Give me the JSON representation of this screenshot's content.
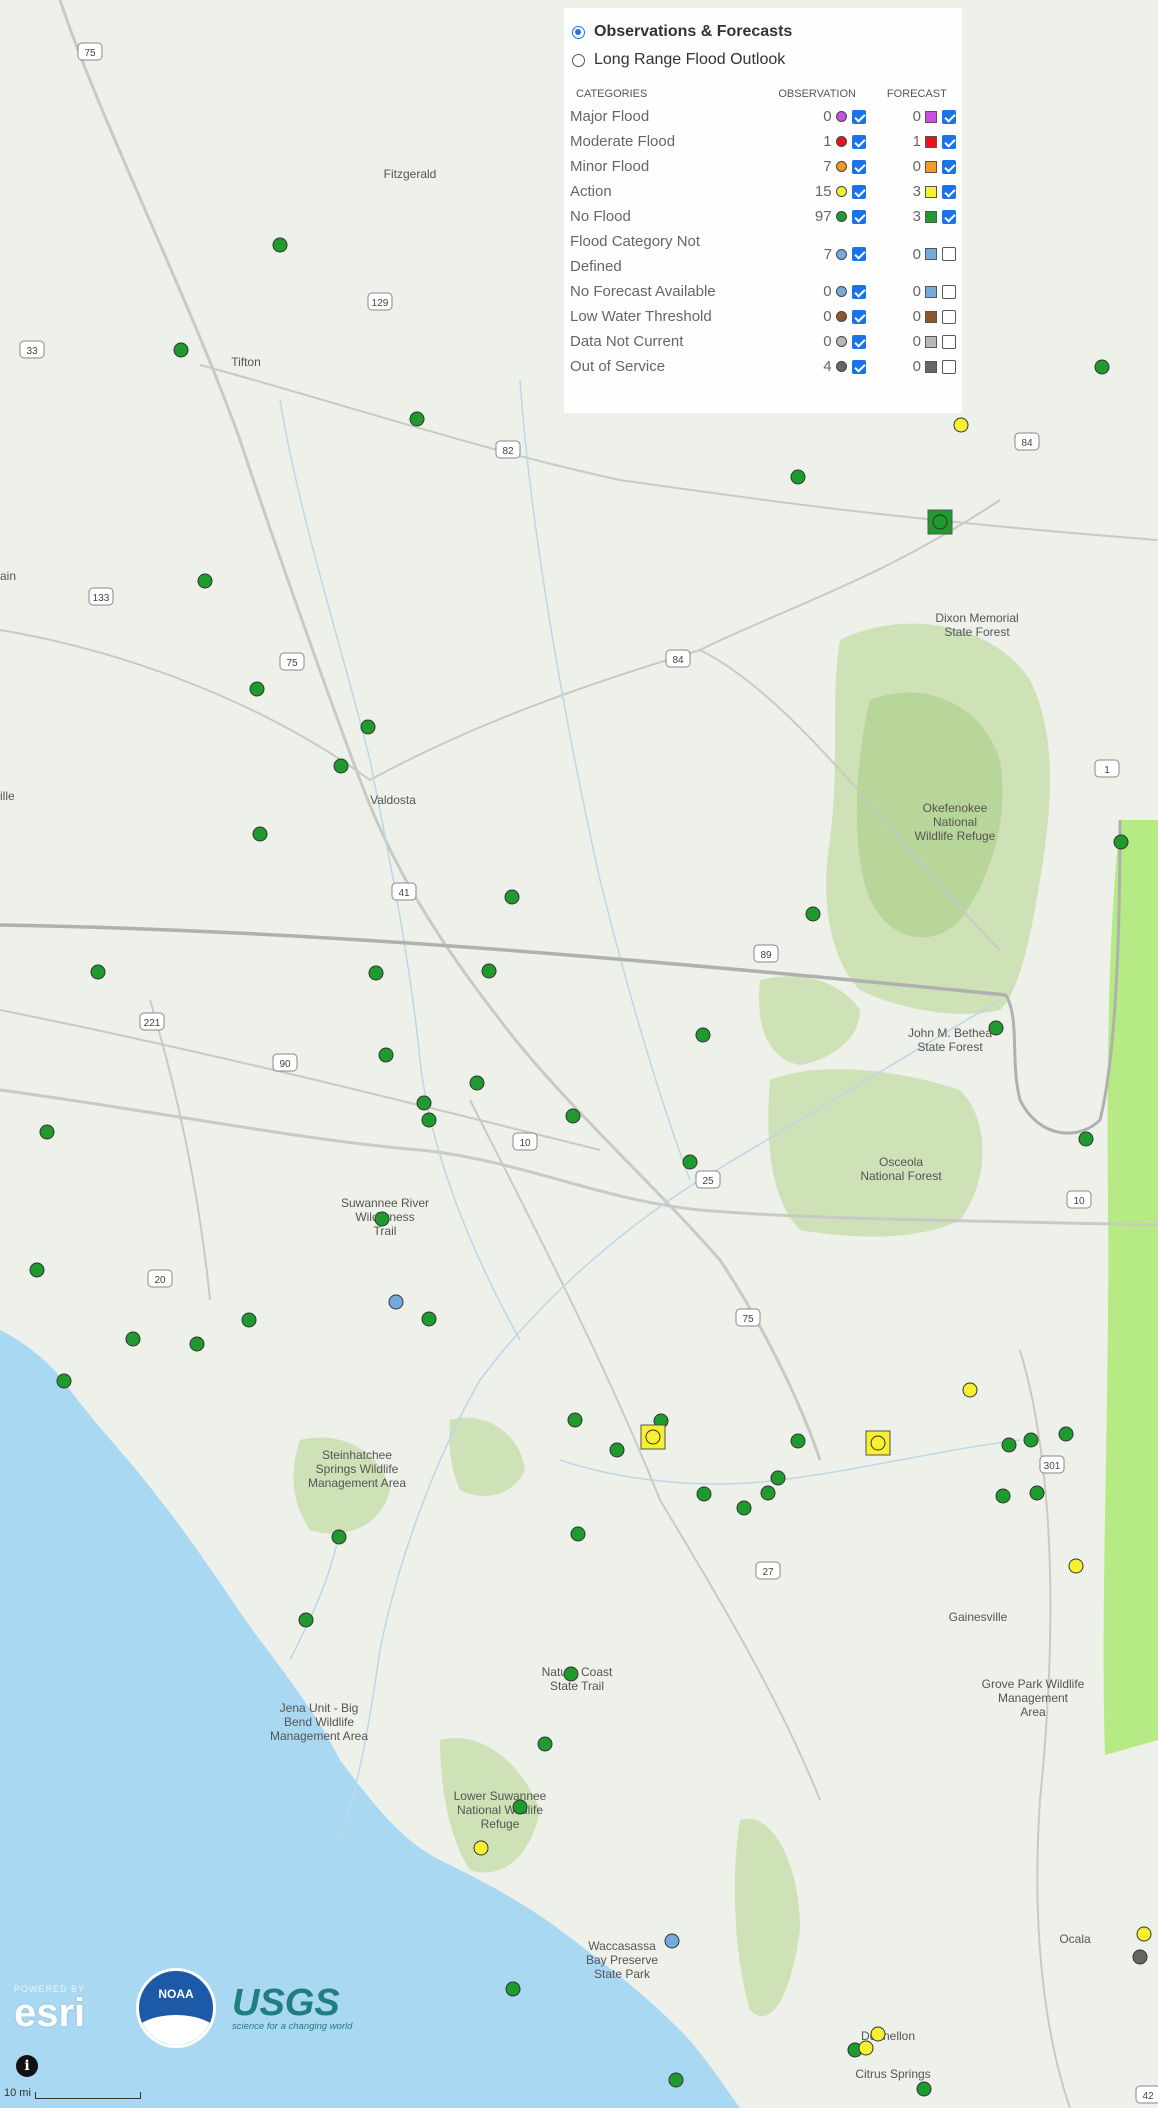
{
  "map": {
    "colors": {
      "land": "#eef0ea",
      "water": "#a9d8f2",
      "forest": "#cfe1b7",
      "park": "#b8d59a",
      "bright_green": "#b6ea84",
      "road": "#b8bab4",
      "river": "#bcd7e8",
      "border": "#b0b0b0",
      "dot_green": "#1f9a2e",
      "dot_yellow": "#f7f030",
      "dot_blue": "#74a9dc",
      "dot_gray": "#666666"
    },
    "place_labels": [
      {
        "text": "Fitzgerald"
      },
      {
        "text": "Tifton"
      },
      {
        "text": "Valdosta"
      },
      {
        "text": "Gainesville"
      },
      {
        "text": "Ocala"
      },
      {
        "text": "Dunnellon"
      },
      {
        "text": "Citrus Springs"
      },
      {
        "text": "ille"
      },
      {
        "text": "ain"
      },
      {
        "text": "Dixon Memorial\nState Forest"
      },
      {
        "text": "Okefenokee\nNational\nWildlife Refuge"
      },
      {
        "text": "John M. Bethea\nState Forest"
      },
      {
        "text": "Osceola\nNational Forest"
      },
      {
        "text": "Suwannee River\nWilderness\nTrail"
      },
      {
        "text": "Steinhatchee\nSprings Wildlife\nManagement Area"
      },
      {
        "text": "Nature Coast\nState Trail"
      },
      {
        "text": "Jena Unit - Big\nBend Wildlife\nManagement Area"
      },
      {
        "text": "Lower Suwannee\nNational Wildlife\nRefuge"
      },
      {
        "text": "Grove Park Wildlife\nManagement\nArea"
      },
      {
        "text": "Waccasassa\nBay Preserve\nState Park"
      }
    ],
    "route_shields": [
      "75",
      "129",
      "33",
      "82",
      "84",
      "133",
      "75",
      "84",
      "1",
      "41",
      "89",
      "221",
      "90",
      "10",
      "25",
      "10",
      "20",
      "75",
      "301",
      "27",
      "42"
    ]
  },
  "legend": {
    "modes": [
      {
        "label": "Observations & Forecasts",
        "selected": true
      },
      {
        "label": "Long Range Flood Outlook",
        "selected": false
      }
    ],
    "headers": {
      "category": "CATEGORIES",
      "observation": "OBSERVATION",
      "forecast": "FORECAST"
    },
    "rows": [
      {
        "label": "Major Flood",
        "obs_count": "0",
        "obs_color": "#c94fe0",
        "obs_checked": true,
        "fc_count": "0",
        "fc_color": "#c94fe0",
        "fc_checked": true
      },
      {
        "label": "Moderate Flood",
        "obs_count": "1",
        "obs_color": "#e8141d",
        "obs_checked": true,
        "fc_count": "1",
        "fc_color": "#e8141d",
        "fc_checked": true
      },
      {
        "label": "Minor Flood",
        "obs_count": "7",
        "obs_color": "#f59a23",
        "obs_checked": true,
        "fc_count": "0",
        "fc_color": "#f59a23",
        "fc_checked": true
      },
      {
        "label": "Action",
        "obs_count": "15",
        "obs_color": "#f7f030",
        "obs_checked": true,
        "fc_count": "3",
        "fc_color": "#f7f030",
        "fc_checked": true
      },
      {
        "label": "No Flood",
        "obs_count": "97",
        "obs_color": "#1f9a2e",
        "obs_checked": true,
        "fc_count": "3",
        "fc_color": "#1f9a2e",
        "fc_checked": true
      },
      {
        "label": "Flood Category Not Defined",
        "obs_count": "7",
        "obs_color": "#74a9dc",
        "obs_checked": true,
        "fc_count": "0",
        "fc_color": "#74a9dc",
        "fc_checked": false
      },
      {
        "label": "No Forecast Available",
        "obs_count": "0",
        "obs_color": "#74a9dc",
        "obs_checked": true,
        "fc_count": "0",
        "fc_color": "#74a9dc",
        "fc_checked": false
      },
      {
        "label": "Low Water Threshold",
        "obs_count": "0",
        "obs_color": "#8b5a2b",
        "obs_checked": true,
        "fc_count": "0",
        "fc_color": "#8b5a2b",
        "fc_checked": false
      },
      {
        "label": "Data Not Current",
        "obs_count": "0",
        "obs_color": "#b8b8b8",
        "obs_checked": true,
        "fc_count": "0",
        "fc_color": "#b8b8b8",
        "fc_checked": false
      },
      {
        "label": "Out of Service",
        "obs_count": "4",
        "obs_color": "#666666",
        "obs_checked": true,
        "fc_count": "0",
        "fc_color": "#666666",
        "fc_checked": false
      }
    ]
  },
  "footer": {
    "esri_powered": "POWERED BY",
    "esri_name": "esri",
    "noaa_name": "NOAA",
    "usgs_name": "USGS",
    "usgs_tagline": "science for a changing world",
    "info_glyph": "i",
    "scale_label": "10 mi"
  }
}
